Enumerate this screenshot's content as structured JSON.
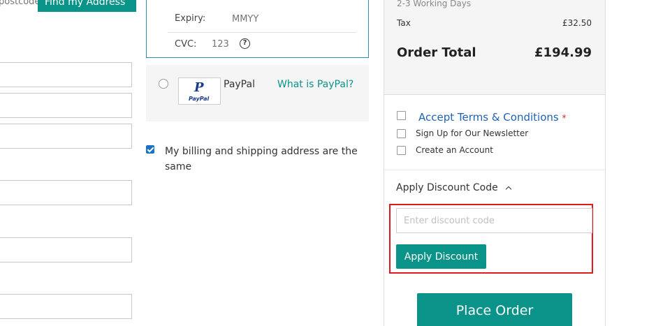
{
  "address": {
    "postcode_placeholder": "postcode",
    "find_button": "Find my Address"
  },
  "card": {
    "expiry_label": "Expiry:",
    "expiry_placeholder": "MMYY",
    "cvc_label": "CVC:",
    "cvc_placeholder": "123",
    "help_symbol": "?"
  },
  "paypal": {
    "logo_text": "PayPal",
    "label": "PayPal",
    "link": "What is PayPal?"
  },
  "billing": {
    "checked": true,
    "label": "My billing and shipping address are the same"
  },
  "summary": {
    "shipping_days": "2-3 Working Days",
    "tax_label": "Tax",
    "tax_value": "£32.50",
    "total_label": "Order Total",
    "total_value": "£194.99"
  },
  "options": {
    "terms_label": "Accept Terms & Conditions",
    "terms_required": "*",
    "newsletter_label": "Sign Up for Our Newsletter",
    "account_label": "Create an Account"
  },
  "discount": {
    "toggle_label": "Apply Discount Code",
    "placeholder": "Enter discount code",
    "apply_button": "Apply Discount"
  },
  "place_order_button": "Place Order",
  "colors": {
    "accent": "#0a9389",
    "link_blue": "#1f63b5",
    "highlight_red": "#e0191f",
    "card_border": "#2f8fb0"
  }
}
